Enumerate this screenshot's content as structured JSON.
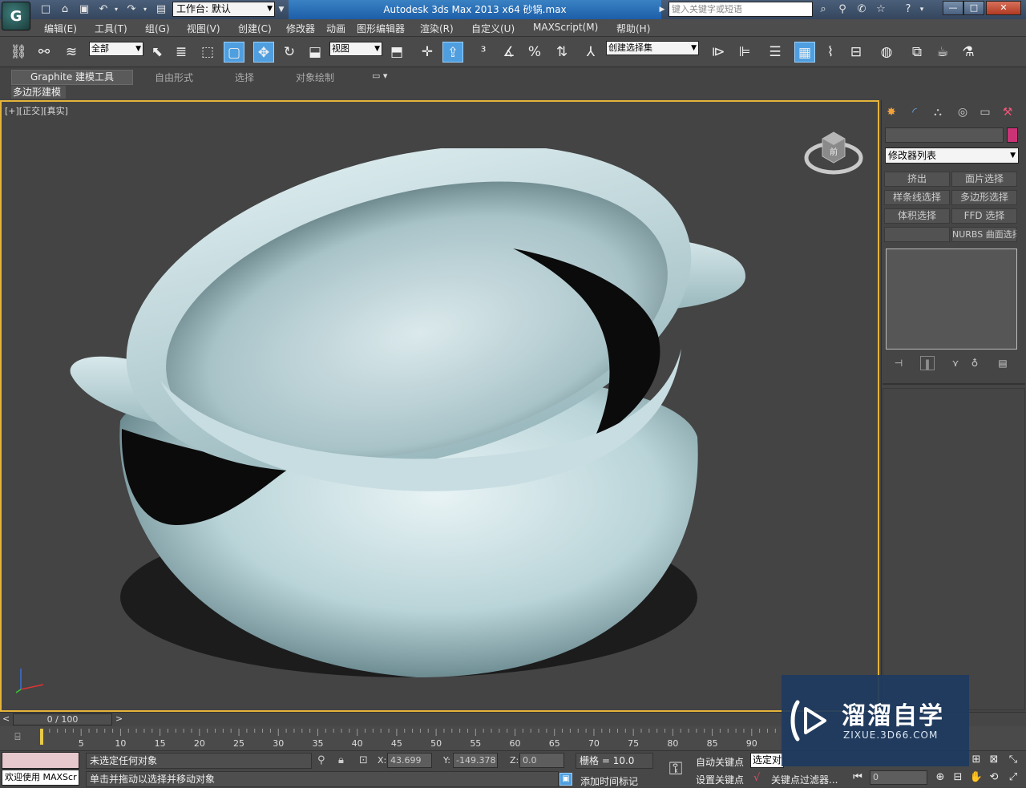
{
  "app": {
    "logo_glyph": "G",
    "workspace": "工作台: 默认",
    "title": "Autodesk 3ds Max  2013 x64      砂锅.max",
    "search_placeholder": "键入关键字或短语",
    "window_min": "—",
    "window_max": "□",
    "window_close": "✕"
  },
  "menu": {
    "items": [
      "编辑(E)",
      "工具(T)",
      "组(G)",
      "视图(V)",
      "创建(C)",
      "修改器",
      "动画",
      "图形编辑器",
      "渲染(R)",
      "自定义(U)",
      "MAXScript(M)",
      "帮助(H)"
    ]
  },
  "toolbar": {
    "selection_filter": "全部",
    "ref_coord": "视图",
    "named_selection": "创建选择集"
  },
  "ribbon": {
    "tabs": [
      "Graphite 建模工具",
      "自由形式",
      "选择",
      "对象绘制"
    ],
    "subtab": "多边形建模",
    "dropdown_glyph": "▭ ▾"
  },
  "viewport": {
    "label": "[+][正交][真实]",
    "viewcube_face": "前",
    "object": "砂锅",
    "object_color": "#b9d4d8"
  },
  "command_panel": {
    "tabs": [
      "✸",
      "◜",
      "⛬",
      "◎",
      "▭",
      "⚒"
    ],
    "modifier_list": "修改器列表",
    "modifier_buttons": [
      "挤出",
      "面片选择",
      "样条线选择",
      "多边形选择",
      "体积选择",
      "FFD 选择",
      "",
      "NURBS 曲面选择"
    ],
    "stack_tools": [
      "⊣",
      "‖",
      "⋎",
      "♁",
      "▤"
    ]
  },
  "timeline": {
    "slider": "0 / 100",
    "ticks": [
      0,
      5,
      10,
      15,
      20,
      25,
      30,
      35,
      40,
      45,
      50,
      55,
      60,
      65,
      70,
      75,
      80,
      85,
      90
    ],
    "prev": "<",
    "next": ">"
  },
  "status": {
    "selection_info": "未选定任何对象",
    "prompt": "单击并拖动以选择并移动对象",
    "maxscript_welcome": "欢迎使用 MAXScr",
    "x_label": "X:",
    "x_value": "43.699",
    "y_label": "Y:",
    "y_value": "-149.378",
    "z_label": "Z:",
    "z_value": "0.0",
    "grid": "栅格 = 10.0",
    "add_time_tag": "添加时间标记",
    "auto_key": "自动关键点",
    "set_key": "设置关键点",
    "selection_set": "选定对",
    "key_filters": "关键点过滤器...",
    "frame": "0"
  },
  "watermark": {
    "title": "溜溜自学",
    "subtitle": "ZIXUE.3D66.COM"
  },
  "colors": {
    "accent": "#4f9fe0",
    "viewport_border": "#e4b33a",
    "title_active": "#1d5ea8"
  }
}
